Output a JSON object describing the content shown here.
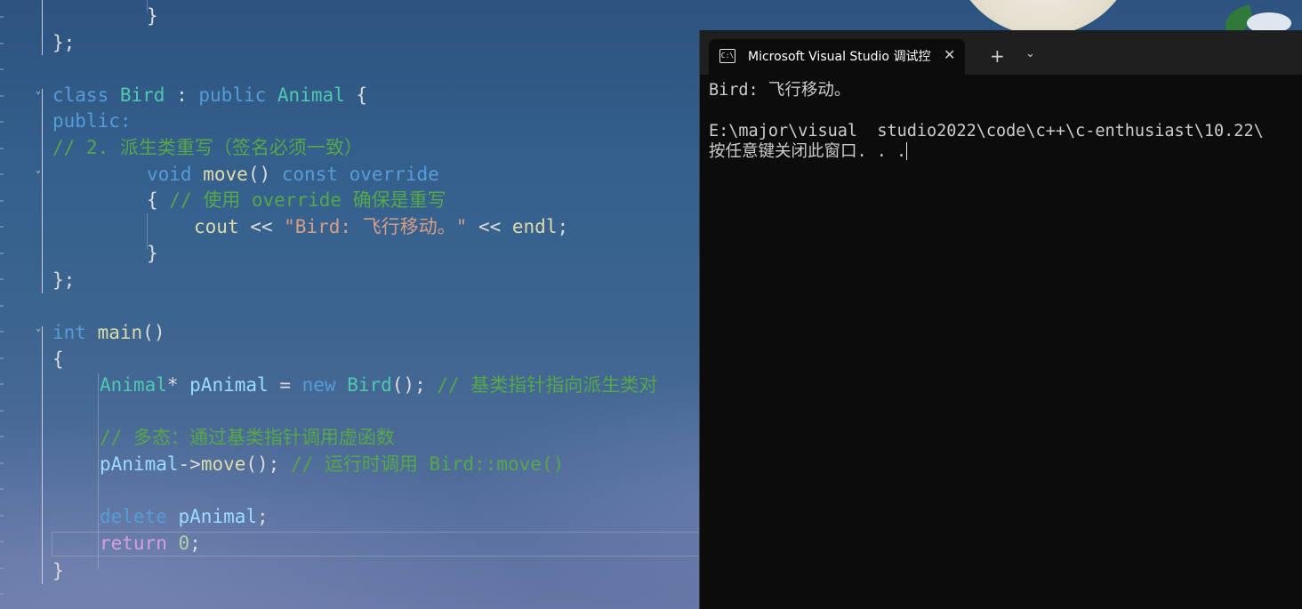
{
  "editor": {
    "lines": [
      {
        "i": 0,
        "t": "}"
      },
      {
        "i": 1,
        "t": "};"
      },
      {
        "i": 2,
        "t": ""
      },
      {
        "i": 3,
        "t": "class Bird : public Animal {"
      },
      {
        "i": 4,
        "t": "public:"
      },
      {
        "i": 5,
        "t": "// 2. 派生类重写（签名必须一致）"
      },
      {
        "i": 6,
        "t": "void move() const override"
      },
      {
        "i": 7,
        "t": "{ // 使用 override 确保是重写"
      },
      {
        "i": 8,
        "t": "cout << \"Bird: 飞行移动。\" << endl;"
      },
      {
        "i": 9,
        "t": "}"
      },
      {
        "i": 10,
        "t": "};"
      },
      {
        "i": 11,
        "t": ""
      },
      {
        "i": 12,
        "t": "int main()"
      },
      {
        "i": 13,
        "t": "{"
      },
      {
        "i": 14,
        "t": "Animal* pAnimal = new Bird(); // 基类指针指向派生类对"
      },
      {
        "i": 15,
        "t": ""
      },
      {
        "i": 16,
        "t": "// 多态：通过基类指针调用虚函数"
      },
      {
        "i": 17,
        "t": "pAnimal->move(); // 运行时调用 Bird::move()"
      },
      {
        "i": 18,
        "t": ""
      },
      {
        "i": 19,
        "t": "delete pAnimal;"
      },
      {
        "i": 20,
        "t": "return 0;"
      },
      {
        "i": 21,
        "t": "}"
      }
    ]
  },
  "terminal": {
    "tab_title": "Microsoft Visual Studio 调试控",
    "tab_icon": "C:\\",
    "close_icon": "✕",
    "add_icon": "+",
    "dropdown_icon": "⌄",
    "output": [
      "Bird: 飞行移动。",
      "",
      "E:\\major\\visual  studio2022\\code\\c++\\c-enthusiast\\10.22\\",
      "按任意键关闭此窗口. . ."
    ]
  }
}
